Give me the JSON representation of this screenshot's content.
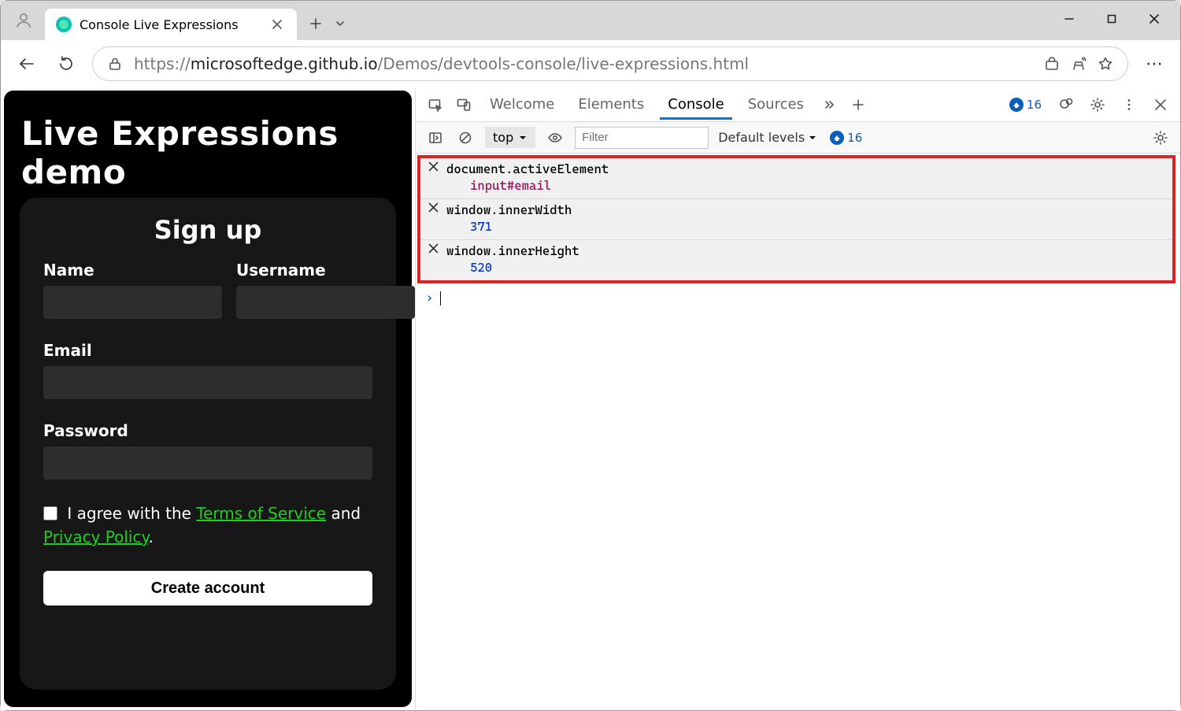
{
  "browser": {
    "tab_title": "Console Live Expressions",
    "url_prefix": "https://",
    "url_host": "microsoftedge.github.io",
    "url_path": "/Demos/devtools-console/live-expressions.html"
  },
  "page": {
    "title": "Live Expressions demo",
    "form": {
      "heading": "Sign up",
      "name_label": "Name",
      "username_label": "Username",
      "email_label": "Email",
      "password_label": "Password",
      "agree_text_1": "I agree with the ",
      "tos_link": "Terms of Service",
      "agree_text_2": " and ",
      "privacy_link": "Privacy Policy",
      "agree_text_3": ".",
      "submit_label": "Create account"
    }
  },
  "devtools": {
    "tabs": {
      "welcome": "Welcome",
      "elements": "Elements",
      "console": "Console",
      "sources": "Sources"
    },
    "issue_count": "16",
    "subbar": {
      "context": "top",
      "filter_placeholder": "Filter",
      "levels": "Default levels",
      "issues": "16"
    },
    "live_expressions": [
      {
        "expr": "document.activeElement",
        "value": "input#email",
        "type": "dom"
      },
      {
        "expr": "window.innerWidth",
        "value": "371",
        "type": "num"
      },
      {
        "expr": "window.innerHeight",
        "value": "520",
        "type": "num"
      }
    ]
  }
}
